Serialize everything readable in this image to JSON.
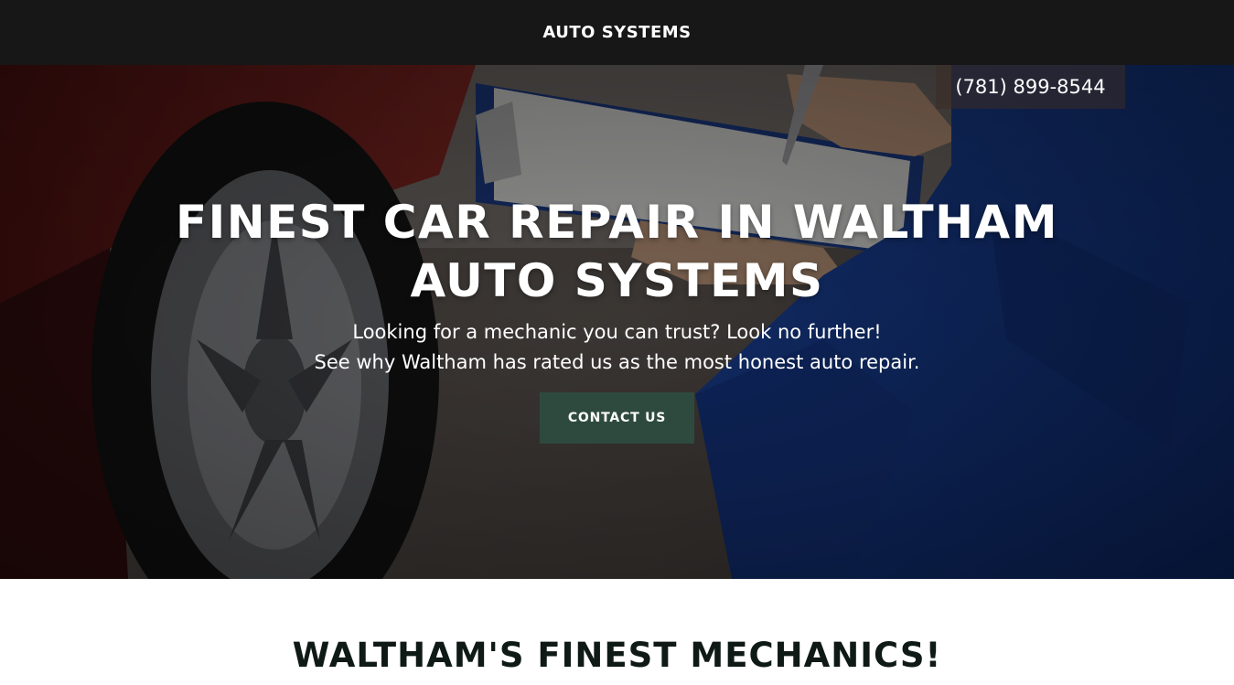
{
  "header": {
    "brand": "AUTO SYSTEMS"
  },
  "hero": {
    "phone": "(781) 899-8544",
    "title_line1": "FINEST CAR REPAIR IN WALTHAM",
    "title_line2": "AUTO SYSTEMS",
    "subtitle_line1": "Looking for a mechanic you can trust? Look no further!",
    "subtitle_line2": "See why Waltham has rated us as the most honest auto repair.",
    "cta_label": "CONTACT US"
  },
  "section": {
    "heading": "WALTHAM'S FINEST MECHANICS!"
  },
  "colors": {
    "topbar": "#171717",
    "cta": "#2e4a3e",
    "heading": "#0f1a16",
    "uniform_blue": "#1a3d8f"
  }
}
